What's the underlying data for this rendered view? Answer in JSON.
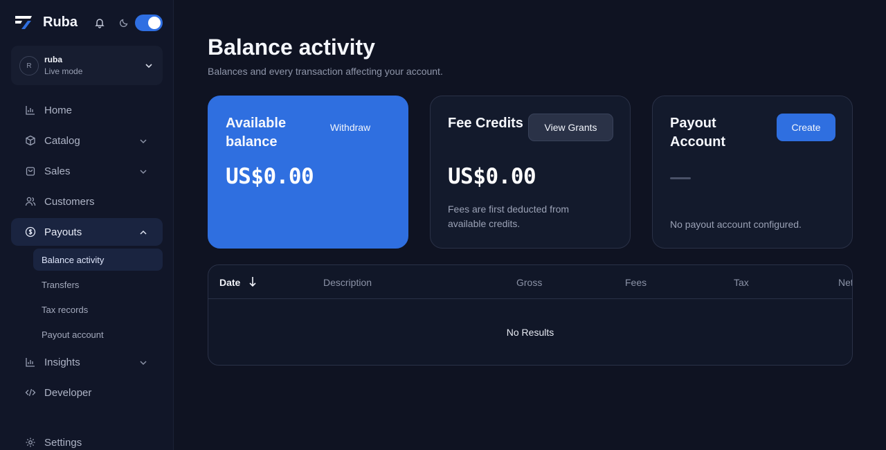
{
  "app": {
    "brand_name": "Ruba",
    "brand_color": "#2f6fe0",
    "theme_toggle_on": true
  },
  "account": {
    "avatar_initial": "R",
    "name": "ruba",
    "mode": "Live mode"
  },
  "sidebar": {
    "items": [
      {
        "label": "Home",
        "icon": "bar-chart-icon"
      },
      {
        "label": "Catalog",
        "icon": "box-icon"
      },
      {
        "label": "Sales",
        "icon": "shopping-bag-icon"
      },
      {
        "label": "Customers",
        "icon": "users-icon"
      },
      {
        "label": "Payouts",
        "icon": "dollar-circle-icon"
      },
      {
        "label": "Insights",
        "icon": "bar-chart-icon"
      },
      {
        "label": "Developer",
        "icon": "code-icon"
      },
      {
        "label": "Settings",
        "icon": "gear-icon"
      }
    ],
    "payouts_sub": [
      {
        "label": "Balance activity",
        "active": true
      },
      {
        "label": "Transfers"
      },
      {
        "label": "Tax records"
      },
      {
        "label": "Payout account"
      }
    ]
  },
  "main": {
    "title": "Balance activity",
    "subtitle": "Balances and every transaction affecting your account.",
    "cards": {
      "available": {
        "title": "Available balance",
        "button": "Withdraw",
        "amount": "US$0.00"
      },
      "fee_credits": {
        "title": "Fee Credits",
        "button": "View Grants",
        "amount": "US$0.00",
        "note": "Fees are first deducted from available credits."
      },
      "payout_account": {
        "title": "Payout Account",
        "button": "Create",
        "note": "No payout account configured."
      }
    },
    "table": {
      "columns": [
        "Date",
        "Description",
        "Gross",
        "Fees",
        "Tax",
        "Net"
      ],
      "empty_text": "No Results"
    }
  }
}
